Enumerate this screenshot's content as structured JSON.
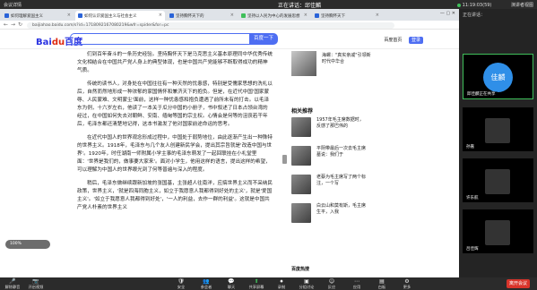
{
  "meeting": {
    "top_left": "会议详情",
    "status": "正在讲话：",
    "speaker": "邱佳麟",
    "clock": "11:19:03(59)",
    "view_label": "演讲者视图"
  },
  "browser": {
    "tabs": [
      "如何理解爱国主义",
      "如何认识爱国主义与社会主义",
      "坚持胸怀天下的",
      "坚持以人民为中心的发展思想",
      "坚持胸怀天下"
    ],
    "url": "baijiahao.baidu.com/s?id=1718092167080219&wfr=spider&for=pc"
  },
  "page": {
    "logo_text": "Bai",
    "logo_paw": "du",
    "logo_suffix": "百度",
    "search_button": "百度一下",
    "links": [
      "百度首页",
      "登录"
    ],
    "article": [
      "们到百年奋斗的一条历史经验。坚持胸怀天下是马克思主义基本原理同中华优秀传统文化相结合在中国共产党人身上的典型体现，也是中国共产党能够不断取得成功的精神气质。",
      "传统的读书人，对身处在中国往往有一种天然的忧患感，特别是受儒家思想的洗礼以后，自然而然地形成一种浓郁的家国情怀和兼济天下的抱负。但是，在近代中国'国家蒙辱、人民蒙难、文明蒙尘'面前，这样一种忧患感和抱负遭遇了前所未有的打击。以毛泽东为例，十六岁左右，他读了一本关于瓜分中国的小册子，书中叙述了日本占领台湾的经过，在中国如何失去对朝鲜、安南、缅甸等国的宗主权。心情会是何等的沮丧若干年后，毛泽东都还清楚地记得，这本书激发了他对国家前途命运的思考。",
      "在近代中国人的世界观念形成过程中，中国处于弱势地位，由此逐渐产生出一种殊特的世界主义。1918年，毛泽东与几个友人创建新民学会，提出其宗旨就是'改造中国与世界'。1920年，时任湖南一师附属小学主事的毛泽东萌发了一起回联挂在小礼堂里面：'世界是我们的，做事要大家来'。面对小学生，他用这样的语言，提出这样的希望，可以理解为中国人的世界眼光到了何等普遍与深入的程度。",
      "稍后，毛泽东做继续跟新加坡的张国基，主张超人往南洋，应搞世界主义而不采纳民政策，世界主义，'就是四海同胞主义，如立于我愿意人我都得到好处的主义'，就是'爱国主义'。'如立于我愿意人我都得到好处'，'一人的利益，去作一群的利益'。这就是中国共产党人朴素的世界主义"
    ],
    "related": [
      {
        "title": "海螺：\"真实亲戚\"引领新时代中华合"
      },
      {
        "title": "1957年毛主席数据时，反感了那巴伟的"
      },
      {
        "title": "平阴带最后一次去毛主席墓说：我们于"
      },
      {
        "title": "老蔡为毛主席写了两个标注，一个写"
      },
      {
        "title": "白云山和莫有斯，毛主席生平，入我"
      }
    ],
    "related_heading": "相关推荐",
    "float_control": "100%",
    "footer_label": "百度热搜"
  },
  "panel": {
    "title": "正在讲话：",
    "participants": [
      {
        "name": "佳麟",
        "label": "邱佳麟正在共享",
        "speaking": true
      },
      {
        "name": "",
        "label": "孙嘉",
        "speaking": false
      },
      {
        "name": "",
        "label": "许东航",
        "speaking": false
      },
      {
        "name": "",
        "label": "吕佳辉",
        "speaking": false
      }
    ]
  },
  "toolbar": {
    "items": [
      {
        "icon": "🎤",
        "label": "解除静音"
      },
      {
        "icon": "📷",
        "label": "开启视频"
      },
      {
        "icon": "🛡",
        "label": "安全"
      },
      {
        "icon": "👥",
        "label": "参会者"
      },
      {
        "icon": "💬",
        "label": "聊天"
      },
      {
        "icon": "⬆",
        "label": "共享屏幕"
      },
      {
        "icon": "⏺",
        "label": "录制"
      },
      {
        "icon": "▣",
        "label": "分组讨论"
      },
      {
        "icon": "☺",
        "label": "反应"
      },
      {
        "icon": "⋯",
        "label": "应用"
      },
      {
        "icon": "▤",
        "label": "白板"
      },
      {
        "icon": "⚙",
        "label": "更多"
      }
    ],
    "end_label": "离开会议"
  }
}
